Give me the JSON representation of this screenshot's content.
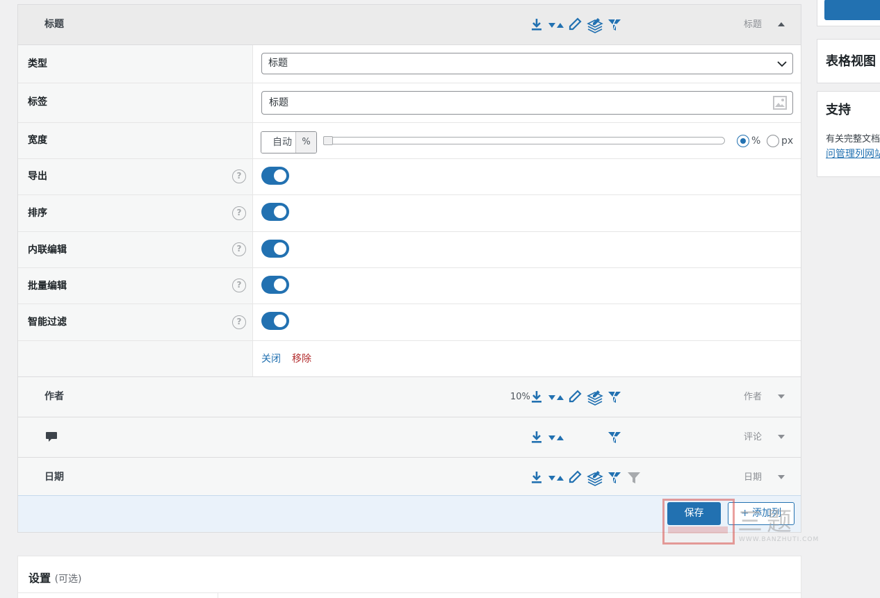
{
  "columns": [
    {
      "title": "标题",
      "type_label": "标题",
      "width_pct": "",
      "expanded": true,
      "icons": [
        "export-icon",
        "sort-icon",
        "edit-icon",
        "bulk-edit-icon",
        "smart-filter-icon"
      ]
    },
    {
      "title": "作者",
      "type_label": "作者",
      "width_pct": "10%",
      "expanded": false,
      "icons": [
        "export-icon",
        "sort-icon",
        "edit-icon",
        "bulk-edit-icon",
        "smart-filter-icon"
      ]
    },
    {
      "title": "",
      "type_label": "评论",
      "width_pct": "",
      "expanded": false,
      "title_icon": "comment-icon",
      "icons": [
        "export-icon",
        "sort-icon",
        "",
        "",
        "smart-filter-icon"
      ]
    },
    {
      "title": "日期",
      "type_label": "日期",
      "width_pct": "",
      "expanded": false,
      "icons": [
        "export-icon",
        "sort-icon",
        "edit-icon",
        "bulk-edit-icon",
        "smart-filter-icon",
        "filter-icon"
      ]
    }
  ],
  "settings": {
    "type": {
      "label": "类型",
      "value": "标题"
    },
    "label": {
      "label": "标签",
      "value": "标题"
    },
    "width": {
      "label": "宽度",
      "placeholder": "自动",
      "unit": "%",
      "unit_options": [
        "%",
        "px"
      ],
      "selected_unit": "%",
      "slider_value": 0
    },
    "toggles": [
      {
        "label": "导出",
        "on": true
      },
      {
        "label": "排序",
        "on": true
      },
      {
        "label": "内联编辑",
        "on": true
      },
      {
        "label": "批量编辑",
        "on": true
      },
      {
        "label": "智能过滤",
        "on": true
      }
    ],
    "close_link": "关闭",
    "remove_link": "移除",
    "help_glyph": "?"
  },
  "footer": {
    "save": "保存",
    "add_column": "+ 添加列"
  },
  "settings_section": {
    "title": "设置",
    "optional": "(可选)"
  },
  "sidebar": {
    "table_view_title": "表格视图",
    "support_title": "支持",
    "support_text": "有关完整文档",
    "support_link": "问管理列网站"
  },
  "watermark": {
    "text": "三题",
    "url": "WWW.BANZHUTI.COM"
  },
  "colors": {
    "accent": "#2271b1",
    "danger": "#b32d2e",
    "footer_bg": "#eaf2fa"
  }
}
